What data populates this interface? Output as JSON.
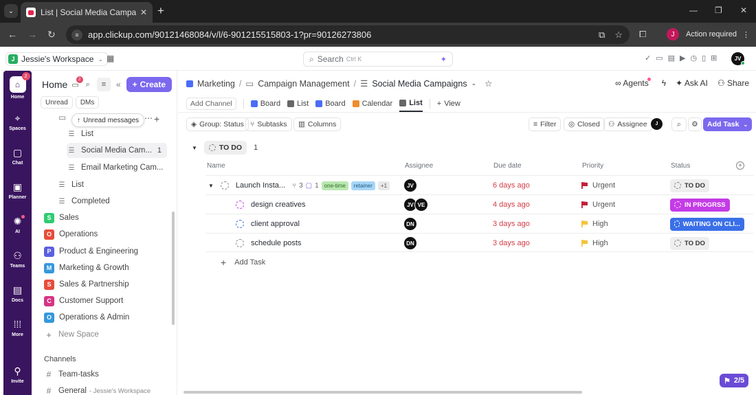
{
  "browser": {
    "tab_title": "List | Social Media Campaigns |",
    "url": "app.clickup.com/90121468084/v/l/6-901215515803-1?pr=90126273806",
    "profile_initial": "J",
    "action_required": "Action required"
  },
  "topbar": {
    "workspace": "Jessie's Workspace",
    "workspace_initial": "J",
    "search_placeholder": "Search",
    "search_shortcut": "Ctrl K",
    "avatar": "JV"
  },
  "rail": {
    "items": [
      {
        "label": "Home",
        "badge": "2"
      },
      {
        "label": "Spaces"
      },
      {
        "label": "Chat"
      },
      {
        "label": "Planner"
      },
      {
        "label": "AI"
      },
      {
        "label": "Teams"
      },
      {
        "label": "Docs"
      },
      {
        "label": "More"
      },
      {
        "label": "Invite"
      }
    ]
  },
  "sidebar": {
    "home_label": "Home",
    "inbox_badge": "2",
    "create_label": "Create",
    "filters": [
      "Unread",
      "DMs"
    ],
    "unread_tip": "Unread messages",
    "tree": [
      {
        "label": "List"
      },
      {
        "label": "Social Media Cam...",
        "count": "1"
      },
      {
        "label": "Email Marketing Cam..."
      },
      {
        "label": "List"
      },
      {
        "label": "Completed"
      }
    ],
    "spaces": [
      {
        "initial": "S",
        "label": "Sales",
        "color": "#2ecc71"
      },
      {
        "initial": "O",
        "label": "Operations",
        "color": "#e74c3c"
      },
      {
        "initial": "P",
        "label": "Product & Engineering",
        "color": "#5b5fe0"
      },
      {
        "initial": "M",
        "label": "Marketing & Growth",
        "color": "#3498db"
      },
      {
        "initial": "S",
        "label": "Sales & Partnership",
        "color": "#e74c3c"
      },
      {
        "initial": "C",
        "label": "Customer Support",
        "color": "#d63384"
      },
      {
        "initial": "O",
        "label": "Operations & Admin",
        "color": "#3498db"
      }
    ],
    "new_space": "New Space",
    "channels_heading": "Channels",
    "channels": [
      {
        "label": "Team-tasks"
      },
      {
        "label": "General",
        "sub": "- Jessie's Workspace"
      }
    ]
  },
  "main": {
    "breadcrumb": [
      "Marketing",
      "Campaign Management",
      "Social Media Campaigns"
    ],
    "agents": "Agents",
    "ask_ai": "Ask AI",
    "share": "Share",
    "add_channel": "Add Channel",
    "views": [
      "Board",
      "List",
      "Board",
      "Calendar",
      "List"
    ],
    "add_view": "View",
    "toolbar": {
      "group": "Group: Status",
      "subtasks": "Subtasks",
      "columns": "Columns",
      "filter": "Filter",
      "closed": "Closed",
      "assignee": "Assignee",
      "avatar": "J",
      "add_task": "Add Task"
    },
    "group": {
      "status": "TO DO",
      "count": "1"
    },
    "columns": [
      "Name",
      "Assignee",
      "Due date",
      "Priority",
      "Status"
    ],
    "tasks": [
      {
        "name": "Launch Insta...",
        "subtasks": "3",
        "comments": "1",
        "tags": [
          "one-time",
          "retainer"
        ],
        "more_tags": "+1",
        "assignees": [
          "JV"
        ],
        "due": "6 days ago",
        "priority": "Urgent",
        "priority_color": "#c0203a",
        "status": "TO DO"
      },
      {
        "name": "design creatives",
        "assignees": [
          "JV",
          "VE"
        ],
        "due": "4 days ago",
        "priority": "Urgent",
        "priority_color": "#c0203a",
        "status": "IN PROGRSS"
      },
      {
        "name": "client approval",
        "assignees": [
          "DN"
        ],
        "due": "3 days ago",
        "priority": "High",
        "priority_color": "#f5c33b",
        "status": "WAITING ON CLI..."
      },
      {
        "name": "schedule posts",
        "assignees": [
          "DN"
        ],
        "due": "3 days ago",
        "priority": "High",
        "priority_color": "#f5c33b",
        "status": "TO DO"
      }
    ],
    "add_task_row": "Add Task",
    "float_counter": "2/5"
  }
}
